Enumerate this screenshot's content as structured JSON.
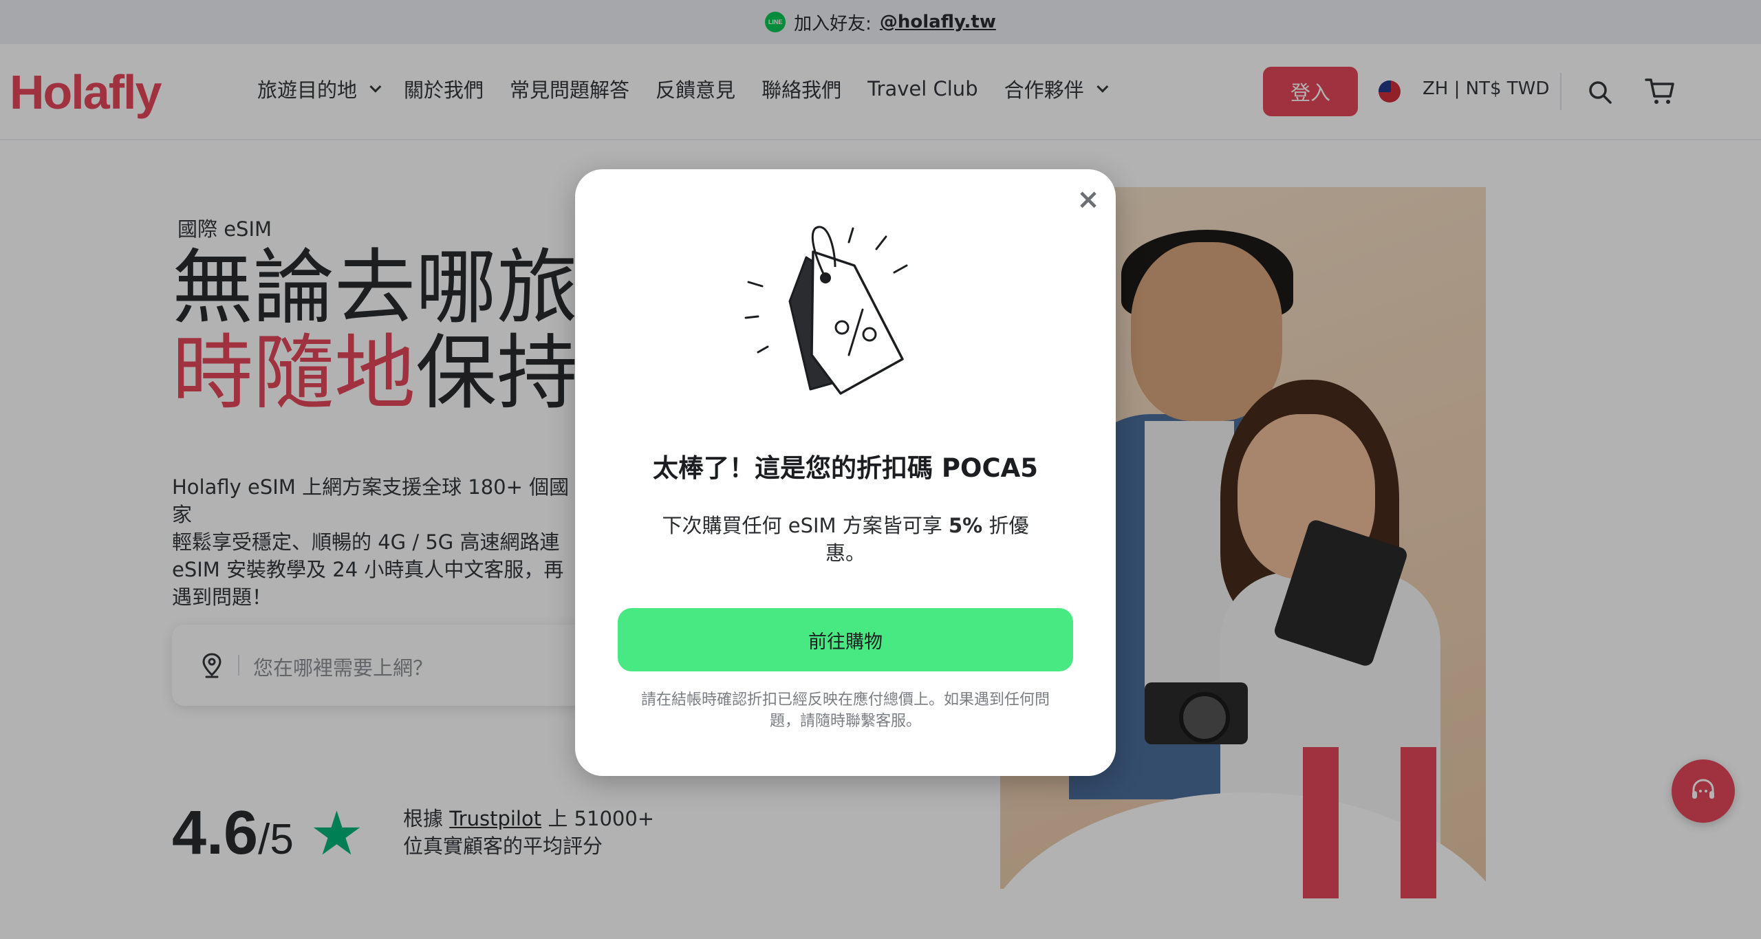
{
  "topbar": {
    "line_icon_text": "LINE",
    "label": "加入好友:",
    "handle": "@holafly.tw"
  },
  "header": {
    "logo": "Holafly",
    "nav": [
      {
        "label": "旅遊目的地",
        "dropdown": true
      },
      {
        "label": "關於我們"
      },
      {
        "label": "常見問題解答"
      },
      {
        "label": "反饋意見"
      },
      {
        "label": "聯絡我們"
      },
      {
        "label": "Travel Club"
      },
      {
        "label": "合作夥伴",
        "dropdown": true
      }
    ],
    "login_label": "登入",
    "locale": "ZH | NT$ TWD",
    "icons": {
      "flag": "taiwan-flag-icon",
      "search": "search-icon",
      "cart": "cart-icon"
    }
  },
  "hero": {
    "eyebrow": "國際 eSIM",
    "title_line1": "無論去哪旅",
    "title_line2_accent": "時隨地",
    "title_line2_rest": "保持",
    "description_lines": [
      "Holafly eSIM 上網方案支援全球 180+ 個國家",
      "輕鬆享受穩定、順暢的 4G / 5G 高速網路連",
      "eSIM 安裝教學及 24 小時真人中文客服，再",
      "遇到問題！"
    ],
    "search_placeholder": "您在哪裡需要上網？",
    "rating": {
      "score": "4.6",
      "out_of": "/5",
      "text_prefix": "根據",
      "trustpilot": "Trustpilot",
      "text_suffix": "上 51000+",
      "text_line2": "位真實顧客的平均評分"
    }
  },
  "modal": {
    "title": "太棒了！這是您的折扣碼 POCA5",
    "body_prefix": "下次購買任何 eSIM 方案皆可享",
    "body_bold": "5%",
    "body_suffix": "折優惠。",
    "button_label": "前往購物",
    "note": "請在結帳時確認折扣已經反映在應付總價上。如果遇到任何問題，請隨時聯繫客服。",
    "close_symbol": "×"
  },
  "colors": {
    "brand": "#e6485c",
    "cta_green": "#48e982",
    "trustpilot_green": "#00b67a",
    "line_green": "#06c755"
  }
}
